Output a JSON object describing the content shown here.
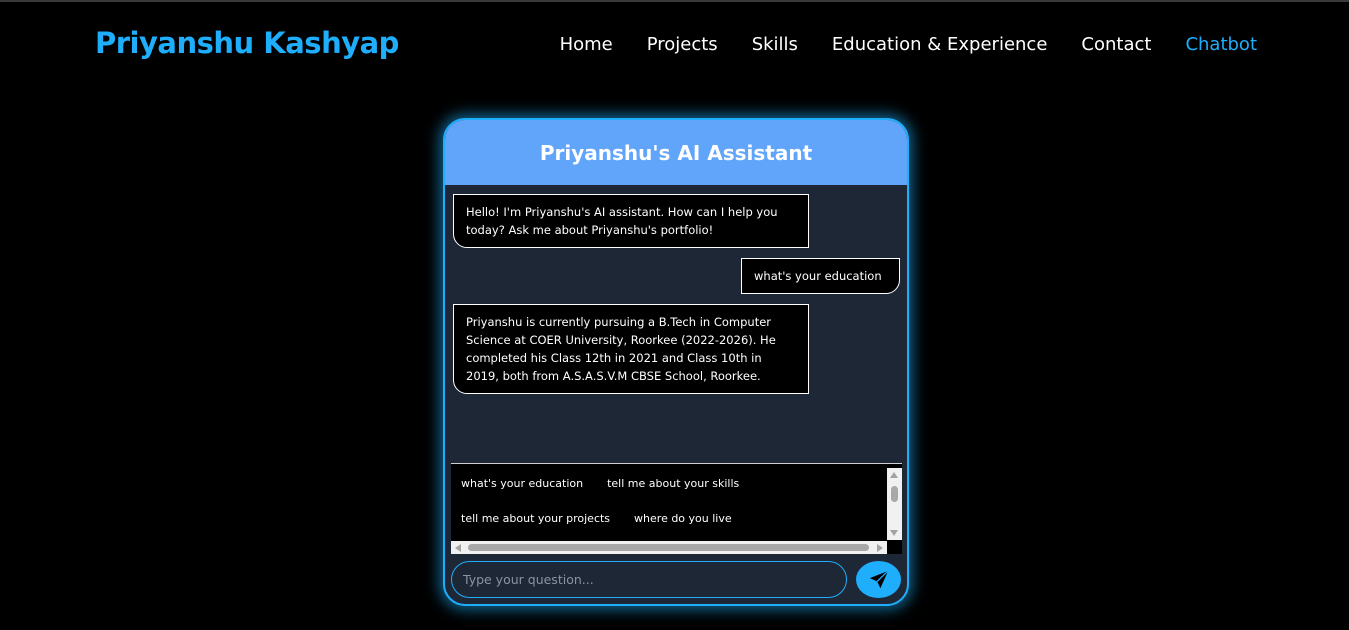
{
  "header": {
    "brand": "Priyanshu Kashyap",
    "nav": [
      {
        "label": "Home",
        "active": false
      },
      {
        "label": "Projects",
        "active": false
      },
      {
        "label": "Skills",
        "active": false
      },
      {
        "label": "Education & Experience",
        "active": false
      },
      {
        "label": "Contact",
        "active": false
      },
      {
        "label": "Chatbot",
        "active": true
      }
    ]
  },
  "chat": {
    "title": "Priyanshu's AI Assistant",
    "messages": [
      {
        "role": "bot",
        "text": "Hello! I'm Priyanshu's AI assistant. How can I help you today? Ask me about Priyanshu's portfolio!"
      },
      {
        "role": "user",
        "text": "what's your education"
      },
      {
        "role": "bot",
        "text": "Priyanshu is currently pursuing a B.Tech in Computer Science at COER University, Roorkee (2022-2026). He completed his Class 12th in 2021 and Class 10th in 2019, both from A.S.A.S.V.M CBSE School, Roorkee."
      }
    ],
    "suggestions": [
      "what's your education",
      "tell me about your skills",
      "tell me about your projects",
      "where do you live"
    ],
    "input": {
      "placeholder": "Type your question...",
      "value": ""
    },
    "send_icon": "paper-plane-icon"
  },
  "colors": {
    "accent": "#1eaefc",
    "header_bg": "#60a5fa",
    "chat_bg": "#1e2736",
    "page_bg": "#000000"
  }
}
